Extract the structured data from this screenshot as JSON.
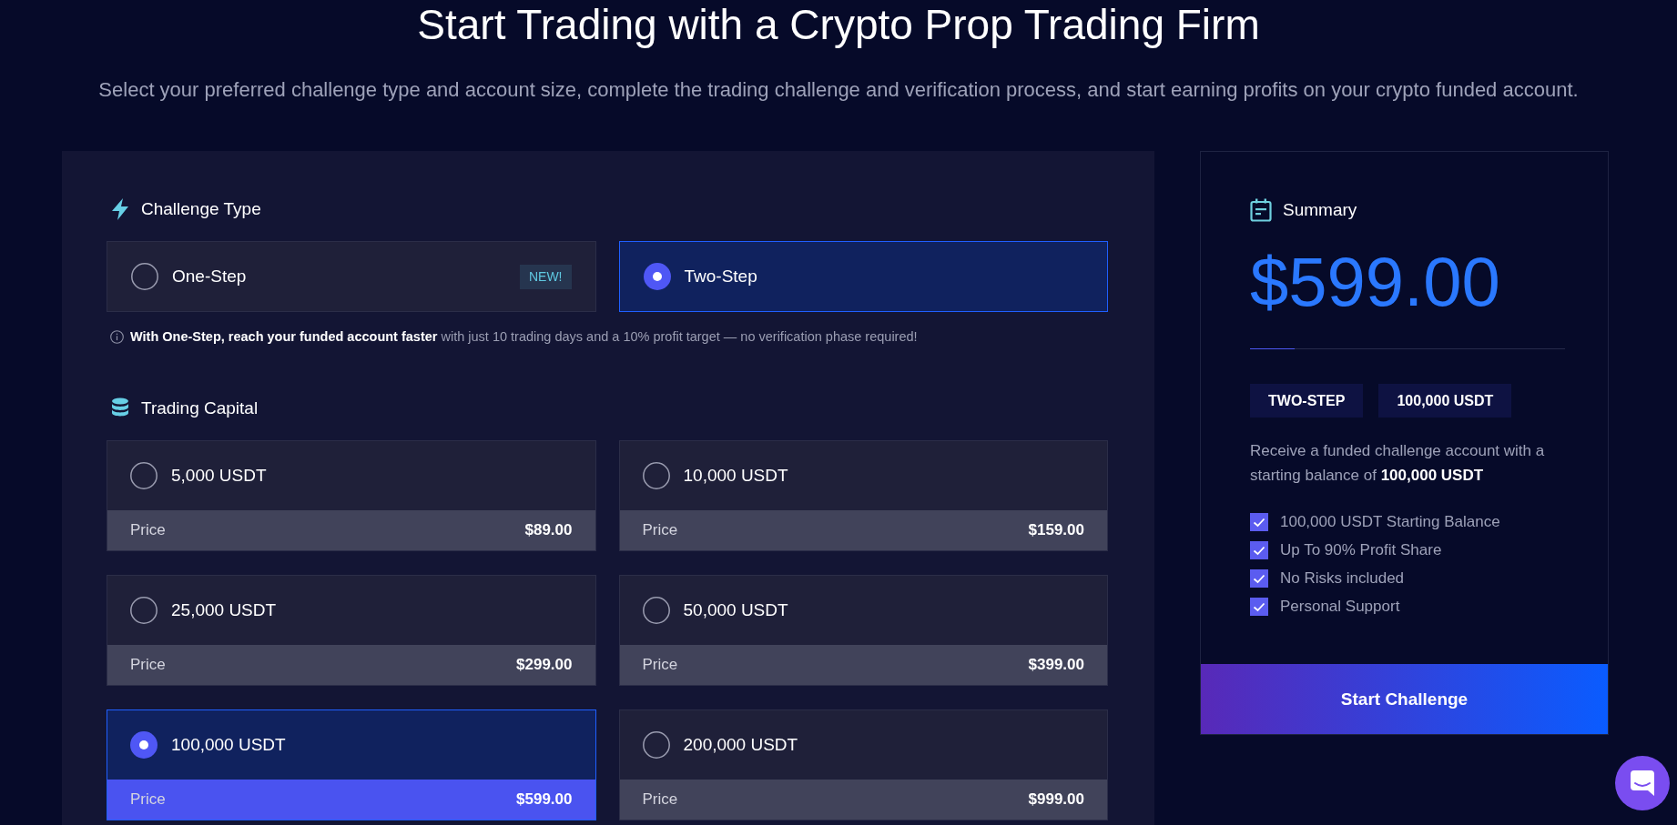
{
  "header": {
    "title": "Start Trading with a Crypto Prop Trading Firm",
    "subtitle": "Select your preferred challenge type and account size, complete the trading challenge and verification process, and start earning profits on your crypto funded account."
  },
  "challenge_type": {
    "heading": "Challenge Type",
    "options": [
      {
        "label": "One-Step",
        "badge": "NEW!",
        "selected": false
      },
      {
        "label": "Two-Step",
        "selected": true
      }
    ],
    "note": "**With One-Step, reach your funded account faster** with just 10 trading days and a 10% profit target — no verification phase required!"
  },
  "trading_capital": {
    "heading": "Trading Capital",
    "options": [
      {
        "label": "5,000 USDT",
        "price_label": "Price",
        "price": "$89.00",
        "selected": false
      },
      {
        "label": "10,000 USDT",
        "price_label": "Price",
        "price": "$159.00",
        "selected": false
      },
      {
        "label": "25,000 USDT",
        "price_label": "Price",
        "price": "$299.00",
        "selected": false
      },
      {
        "label": "50,000 USDT",
        "price_label": "Price",
        "price": "$399.00",
        "selected": false
      },
      {
        "label": "100,000 USDT",
        "price_label": "Price",
        "price": "$599.00",
        "selected": true
      },
      {
        "label": "200,000 USDT",
        "price_label": "Price",
        "price": "$999.00",
        "selected": false
      }
    ]
  },
  "summary": {
    "heading": "Summary",
    "price": "$599.00",
    "tags": [
      "TWO-STEP",
      "100,000 USDT"
    ],
    "description": "Receive a funded challenge account with a starting balance of **100,000 USDT**",
    "features": [
      {
        "label": "100,000 USDT Starting Balance",
        "checked": true
      },
      {
        "label": "Up To 90% Profit Share",
        "checked": true
      },
      {
        "label": "No Risks included",
        "checked": true
      },
      {
        "label": "Personal Support",
        "checked": true
      }
    ],
    "button": "Start Challenge"
  }
}
